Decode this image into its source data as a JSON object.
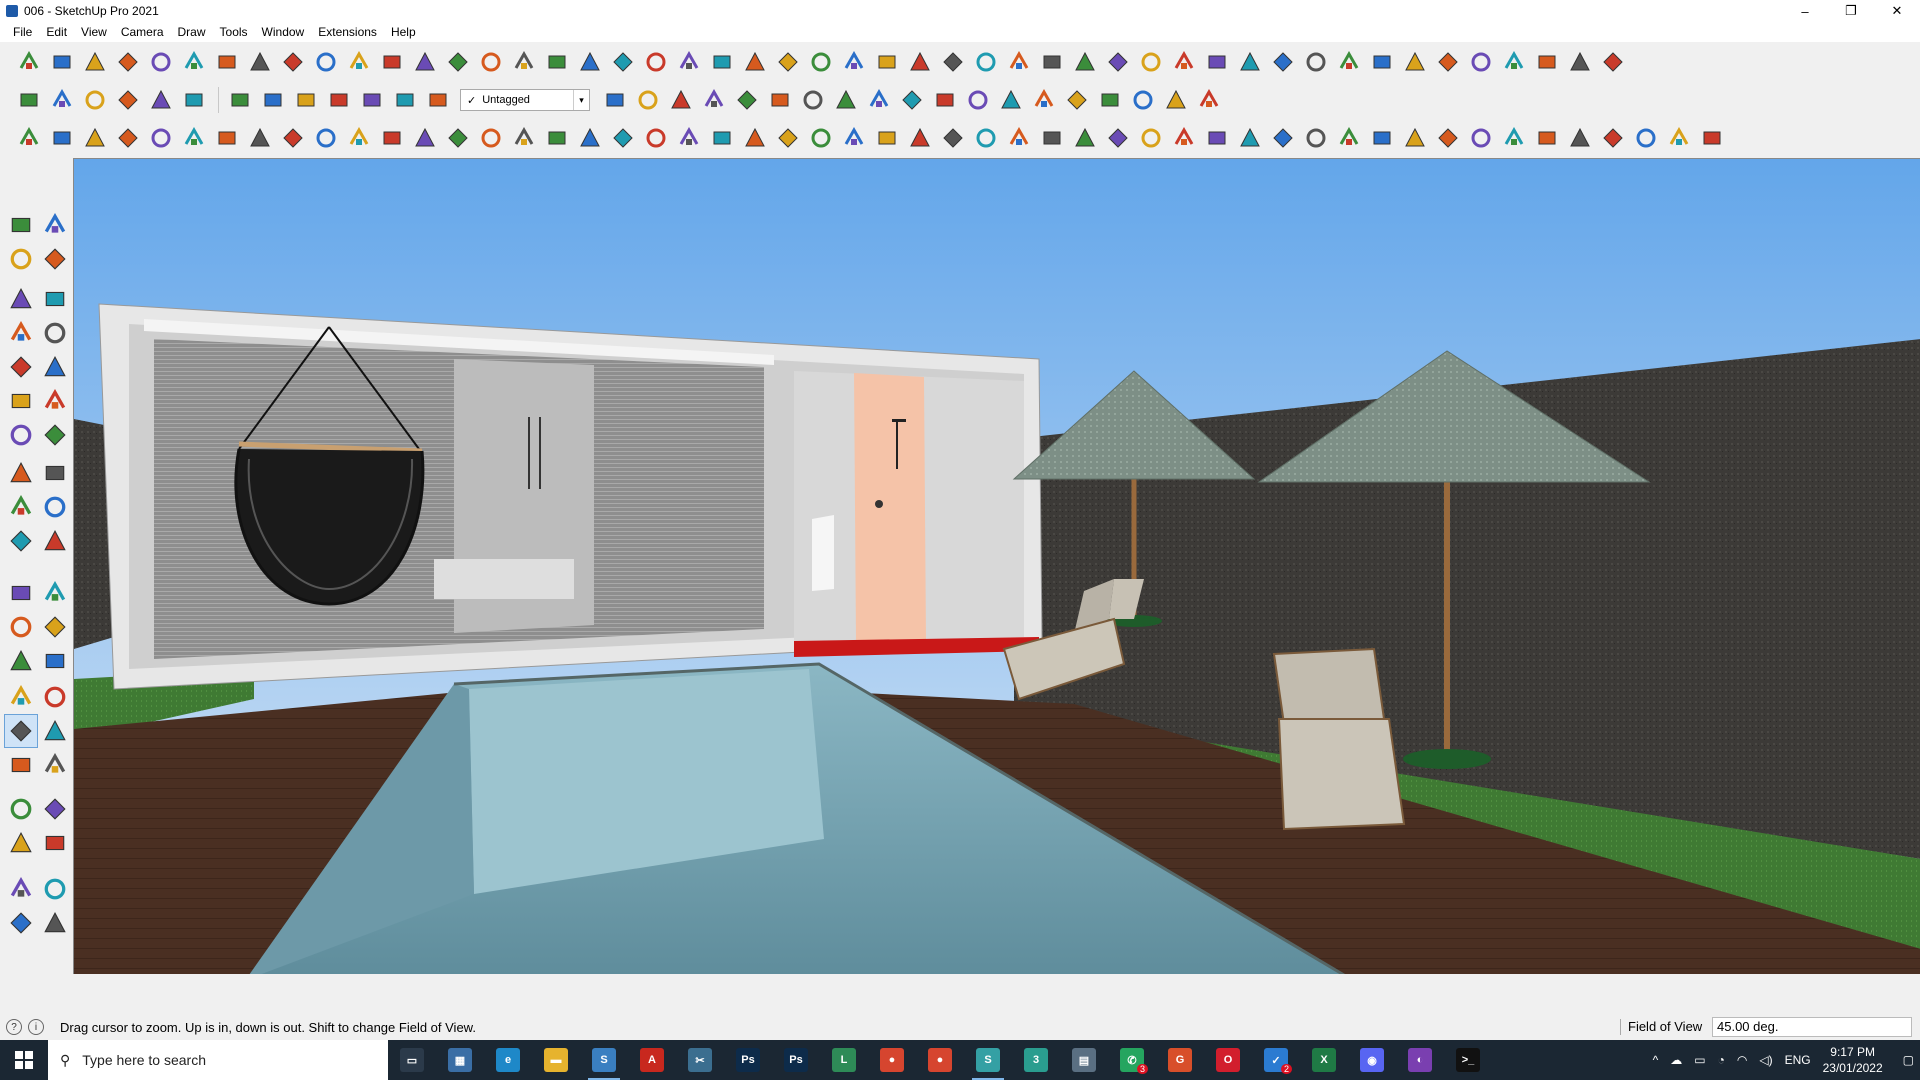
{
  "window": {
    "title": "006 - SketchUp Pro 2021",
    "controls": {
      "minimize": "–",
      "maximize": "❐",
      "close": "✕"
    }
  },
  "menu": [
    "File",
    "Edit",
    "View",
    "Camera",
    "Draw",
    "Tools",
    "Window",
    "Extensions",
    "Help"
  ],
  "toolbar": {
    "tag_dropdown": {
      "check": "✓",
      "value": "Untagged",
      "arrow": "▾"
    }
  },
  "status": {
    "message": "Drag cursor to zoom.  Up is in, down is out. Shift to change Field of View.",
    "fov_label": "Field of View",
    "fov_value": "45.00 deg."
  },
  "taskbar": {
    "search_placeholder": "Type here to search",
    "apps": [
      {
        "name": "task-view",
        "color": "#2b3a4a",
        "glyph": "▭"
      },
      {
        "name": "calculator-app",
        "color": "#3a6ea5",
        "glyph": "▦"
      },
      {
        "name": "edge-browser",
        "color": "#1e88c8",
        "glyph": "e"
      },
      {
        "name": "file-explorer",
        "color": "#e6b32e",
        "glyph": "▬"
      },
      {
        "name": "sketchup-app",
        "color": "#3a7fc1",
        "glyph": "S"
      },
      {
        "name": "acrobat-app",
        "color": "#c8281e",
        "glyph": "A"
      },
      {
        "name": "snipping-app",
        "color": "#3b6e8f",
        "glyph": "✂"
      },
      {
        "name": "photoshop-app",
        "color": "#0d2b4a",
        "glyph": "Ps"
      },
      {
        "name": "photoshop-app-2",
        "color": "#0d2b4a",
        "glyph": "Ps"
      },
      {
        "name": "sketchup-layout",
        "color": "#2e8b57",
        "glyph": "L"
      },
      {
        "name": "chrome-browser",
        "color": "#d6452f",
        "glyph": "●"
      },
      {
        "name": "chrome-browser-2",
        "color": "#d6452f",
        "glyph": "●"
      },
      {
        "name": "sketchup-style",
        "color": "#34a0a4",
        "glyph": "S"
      },
      {
        "name": "app-3",
        "color": "#2a9d8f",
        "glyph": "3"
      },
      {
        "name": "app-notes",
        "color": "#5a6f82",
        "glyph": "▤"
      },
      {
        "name": "whatsapp-app",
        "color": "#25a55f",
        "glyph": "✆"
      },
      {
        "name": "grammarly-app",
        "color": "#d84f2a",
        "glyph": "G"
      },
      {
        "name": "opera-browser",
        "color": "#d21e2d",
        "glyph": "O"
      },
      {
        "name": "vscode-app",
        "color": "#2b7bd1",
        "glyph": "✓"
      },
      {
        "name": "excel-app",
        "color": "#1f7a45",
        "glyph": "X"
      },
      {
        "name": "discord-app",
        "color": "#5865f2",
        "glyph": "◉"
      },
      {
        "name": "app-circle",
        "color": "#7a3fb0",
        "glyph": "◐"
      },
      {
        "name": "terminal-app",
        "color": "#111",
        "glyph": ">_"
      }
    ],
    "badges": {
      "whatsapp": "3",
      "vscode": "2"
    },
    "tray": {
      "chevron": "^",
      "lang": "ENG"
    },
    "clock": {
      "time": "9:17 PM",
      "date": "23/01/2022"
    }
  },
  "colors": {
    "sky_top": "#63a6ea",
    "sky_bottom": "#dce9f6",
    "deck": "#4a2f22",
    "wall": "#3c3a37",
    "grass": "#3f7a33",
    "pool": "#79a9b8",
    "accent_red": "#c91818",
    "door": "#f5c3a8"
  }
}
